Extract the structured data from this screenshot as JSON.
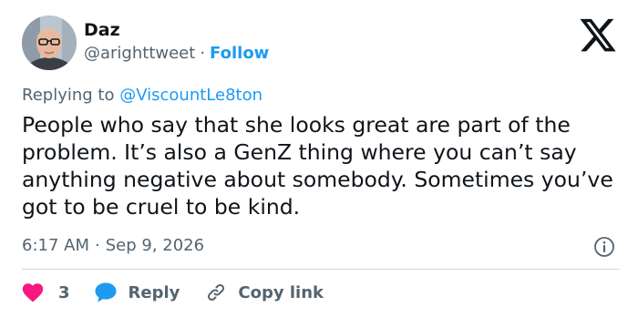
{
  "author": {
    "name": "Daz",
    "handle": "@arighttweet",
    "separator": "·",
    "follow_label": "Follow"
  },
  "replying_to": {
    "prefix": "Replying to",
    "mention": "@ViscountLe8ton"
  },
  "tweet": {
    "text": "People who say that she looks great are part of the problem. It’s also a GenZ thing where you can’t say anything negative about somebody. Sometimes you’ve got to be cruel to be kind."
  },
  "meta": {
    "time": "6:17 AM",
    "separator": "·",
    "date": "Sep 9, 2026"
  },
  "actions": {
    "like_count": "3",
    "reply_label": "Reply",
    "copy_link_label": "Copy link"
  },
  "colors": {
    "text": "#0f1419",
    "secondary": "#536471",
    "link": "#1d9bf0",
    "like": "#f91880",
    "divider": "#cfd9de"
  },
  "icons": {
    "logo": "x-logo-icon",
    "info": "info-icon",
    "like": "heart-icon",
    "reply": "speech-bubble-icon",
    "copy_link": "link-icon"
  }
}
